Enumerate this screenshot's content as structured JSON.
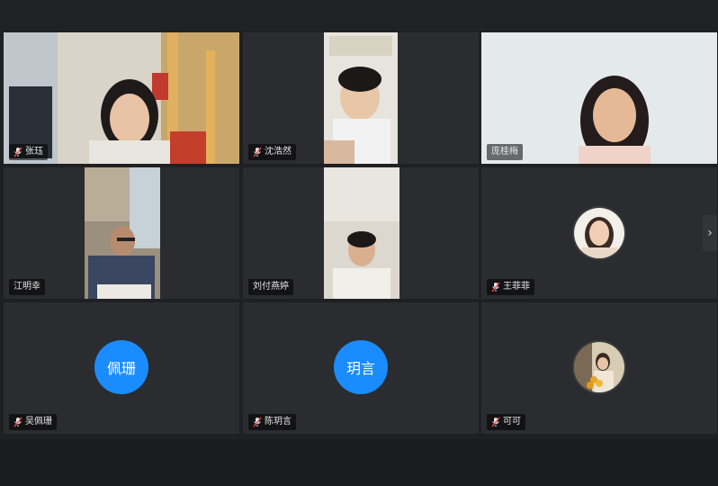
{
  "meeting": {
    "participants": [
      {
        "name": "张珏",
        "muted": true,
        "video": true,
        "active": false
      },
      {
        "name": "沈浩然",
        "muted": true,
        "video": true,
        "active": false
      },
      {
        "name": "庞桂梅",
        "muted": false,
        "video": true,
        "active": true
      },
      {
        "name": "江明幸",
        "muted": false,
        "video": true,
        "active": false
      },
      {
        "name": "刘付燕婷",
        "muted": false,
        "video": true,
        "active": false
      },
      {
        "name": "王菲菲",
        "muted": true,
        "video": false,
        "avatar": "photo-avatar",
        "active": false
      },
      {
        "name": "吴佩珊",
        "muted": true,
        "video": false,
        "avatar_text": "佩珊",
        "active": false
      },
      {
        "name": "陈玥言",
        "muted": true,
        "video": false,
        "avatar_text": "玥言",
        "active": false
      },
      {
        "name": "可可",
        "muted": true,
        "video": false,
        "avatar": "photo-avatar",
        "active": false
      }
    ]
  },
  "colors": {
    "active_border": "#2ecc71",
    "avatar_blue": "#1a8cff",
    "tile_bg": "#2b2c2f"
  },
  "icons": {
    "muted": "mic-off-icon",
    "next": "chevron-right-icon"
  }
}
